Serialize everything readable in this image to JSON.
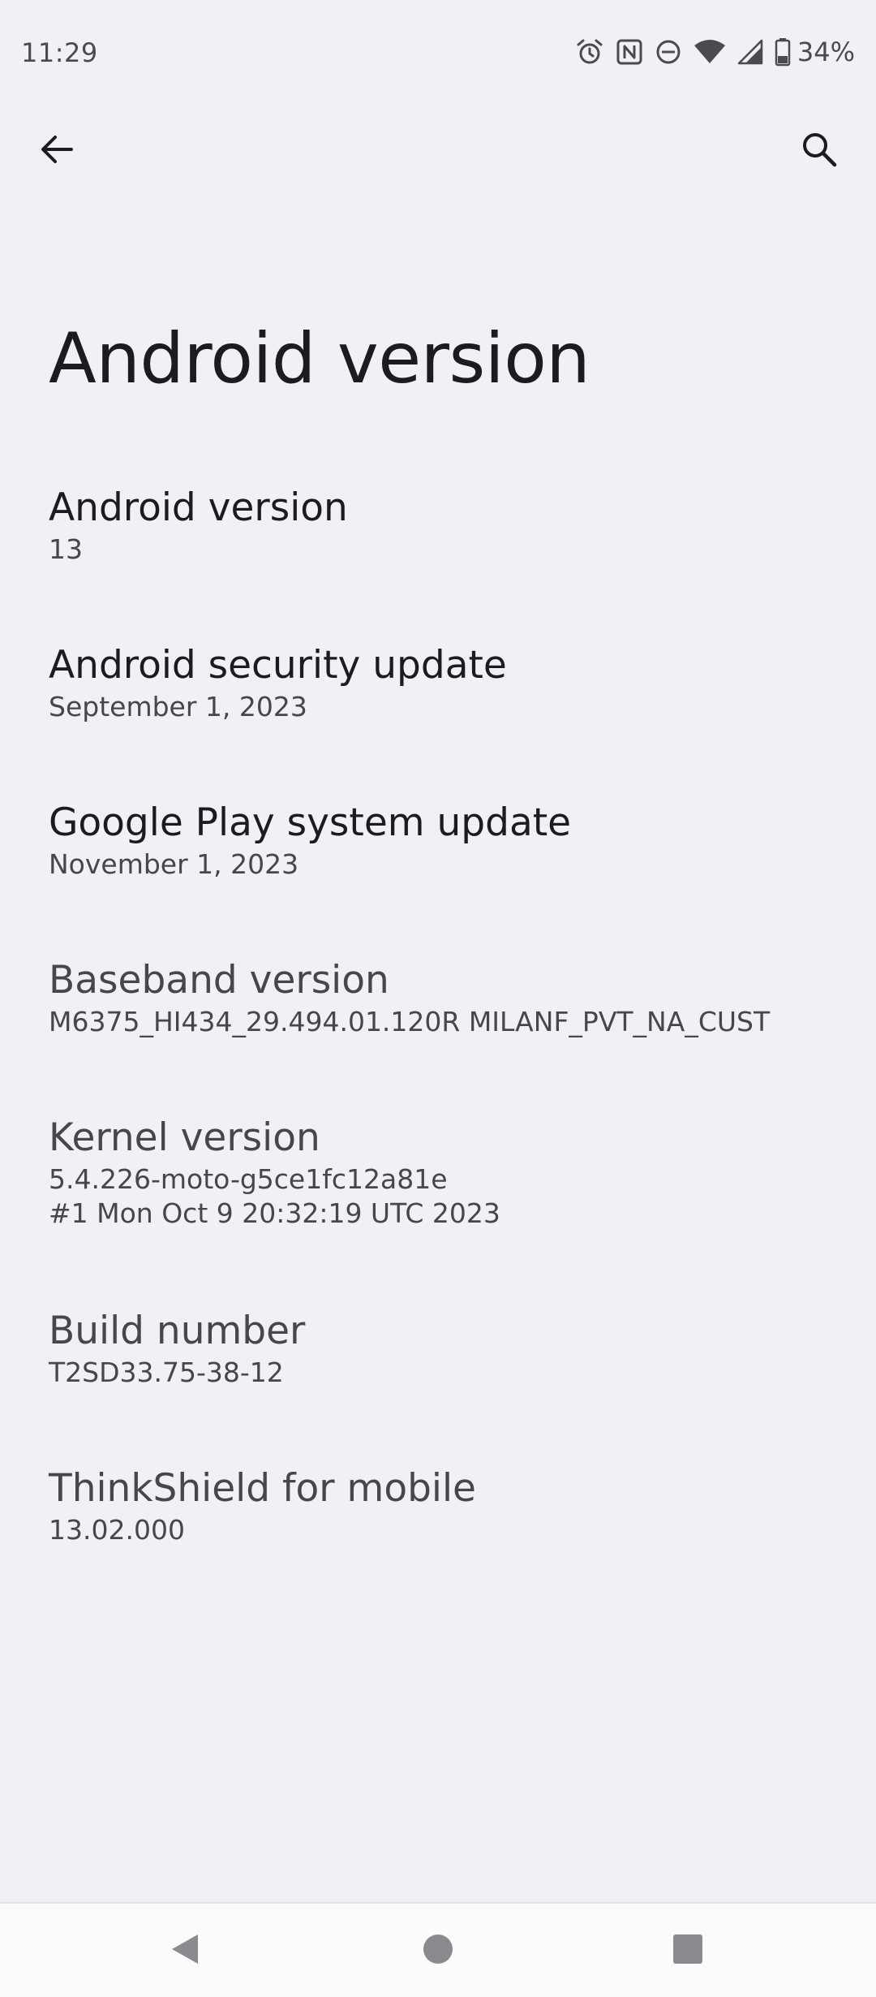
{
  "status_bar": {
    "time": "11:29",
    "battery_percent": "34%",
    "icons": [
      "alarm-icon",
      "nfc-icon",
      "do-not-disturb-icon",
      "wifi-icon",
      "cellular-signal-icon",
      "battery-icon"
    ]
  },
  "app_bar": {
    "back_icon": "arrow-back-icon",
    "search_icon": "search-icon"
  },
  "page": {
    "title": "Android version"
  },
  "items": [
    {
      "title": "Android version",
      "summary": "13"
    },
    {
      "title": "Android security update",
      "summary": "September 1, 2023"
    },
    {
      "title": "Google Play system update",
      "summary": "November 1, 2023"
    },
    {
      "title": "Baseband version",
      "summary": "M6375_HI434_29.494.01.120R MILANF_PVT_NA_CUST"
    },
    {
      "title": "Kernel version",
      "summary": "5.4.226-moto-g5ce1fc12a81e\n#1 Mon Oct 9 20:32:19 UTC 2023"
    },
    {
      "title": "Build number",
      "summary": "T2SD33.75-38-12"
    },
    {
      "title": "ThinkShield for mobile",
      "summary": "13.02.000"
    }
  ],
  "nav_bar": {
    "back_icon": "nav-back-triangle-icon",
    "home_icon": "nav-home-circle-icon",
    "recents_icon": "nav-recents-square-icon"
  },
  "colors": {
    "background": "#f0f1f4",
    "title_text": "#1b1c1f",
    "secondary_text": "#45474c",
    "nav_icon": "#8a8b8e"
  }
}
